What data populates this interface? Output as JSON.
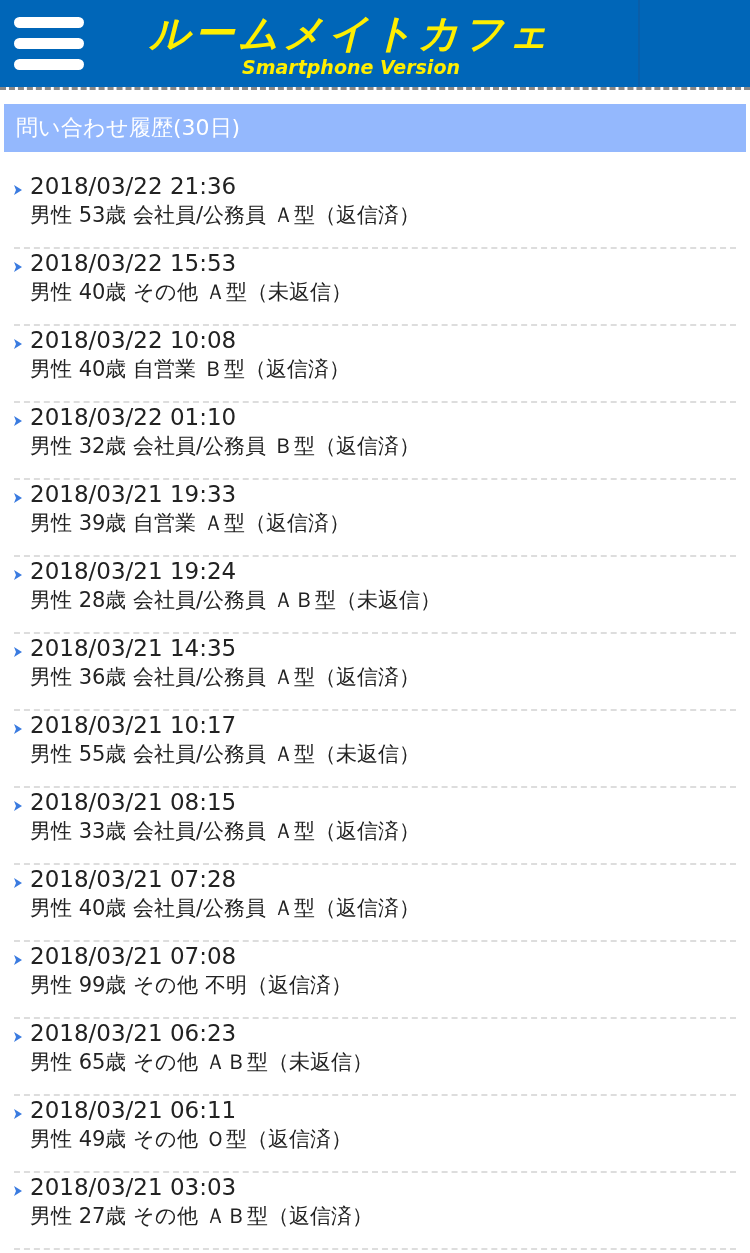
{
  "header": {
    "logo": "ルームメイトカフェ",
    "subtitle": "Smartphone Version"
  },
  "section_title": "問い合わせ履歴(30日)",
  "items": [
    {
      "datetime": "2018/03/22 21:36",
      "detail": "男性 53歳 会社員/公務員 Ａ型（返信済）"
    },
    {
      "datetime": "2018/03/22 15:53",
      "detail": "男性 40歳 その他 Ａ型（未返信）"
    },
    {
      "datetime": "2018/03/22 10:08",
      "detail": "男性 40歳 自営業 Ｂ型（返信済）"
    },
    {
      "datetime": "2018/03/22 01:10",
      "detail": "男性 32歳 会社員/公務員 Ｂ型（返信済）"
    },
    {
      "datetime": "2018/03/21 19:33",
      "detail": "男性 39歳 自営業 Ａ型（返信済）"
    },
    {
      "datetime": "2018/03/21 19:24",
      "detail": "男性 28歳 会社員/公務員 ＡＢ型（未返信）"
    },
    {
      "datetime": "2018/03/21 14:35",
      "detail": "男性 36歳 会社員/公務員 Ａ型（返信済）"
    },
    {
      "datetime": "2018/03/21 10:17",
      "detail": "男性 55歳 会社員/公務員 Ａ型（未返信）"
    },
    {
      "datetime": "2018/03/21 08:15",
      "detail": "男性 33歳 会社員/公務員 Ａ型（返信済）"
    },
    {
      "datetime": "2018/03/21 07:28",
      "detail": "男性 40歳 会社員/公務員 Ａ型（返信済）"
    },
    {
      "datetime": "2018/03/21 07:08",
      "detail": "男性 99歳 その他 不明（返信済）"
    },
    {
      "datetime": "2018/03/21 06:23",
      "detail": "男性 65歳 その他 ＡＢ型（未返信）"
    },
    {
      "datetime": "2018/03/21 06:11",
      "detail": "男性 49歳 その他 Ｏ型（返信済）"
    },
    {
      "datetime": "2018/03/21 03:03",
      "detail": "男性 27歳 その他 ＡＢ型（返信済）"
    }
  ]
}
